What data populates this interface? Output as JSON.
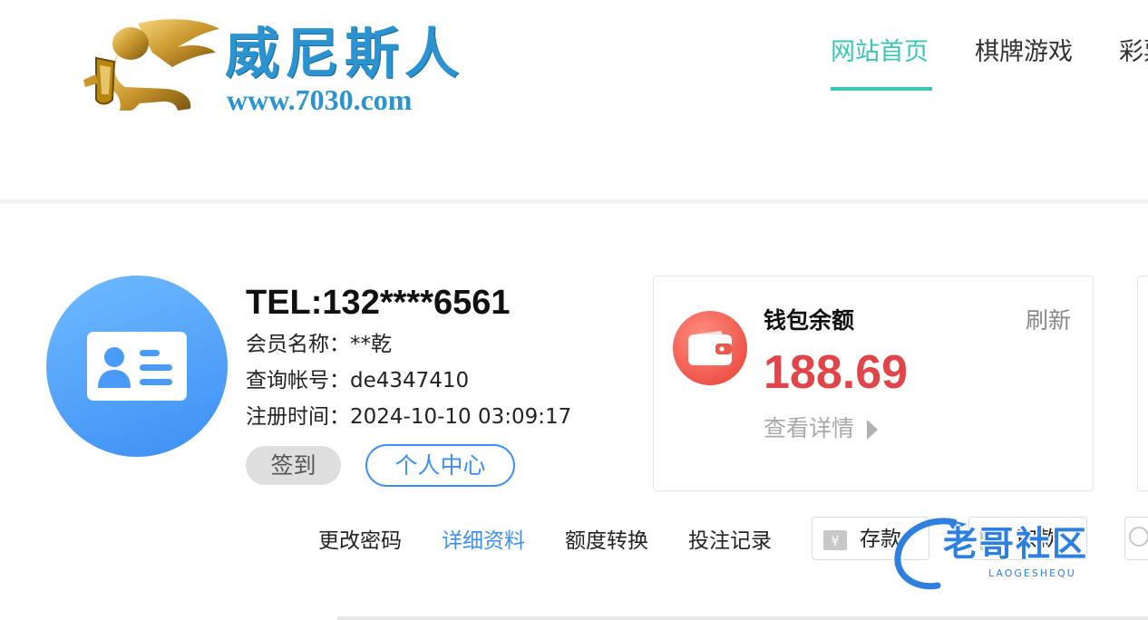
{
  "header": {
    "logo": {
      "name_cn": "威尼斯人",
      "url": "www.7030.com"
    },
    "nav": [
      {
        "label": "网站首页",
        "active": true
      },
      {
        "label": "棋牌游戏",
        "active": false
      },
      {
        "label": "彩票",
        "active": false
      }
    ]
  },
  "profile": {
    "tel": "TEL:132****6561",
    "rows": [
      {
        "label": "会员名称：",
        "value": "**乾"
      },
      {
        "label": "查询帐号：",
        "value": "de4347410"
      },
      {
        "label": "注册时间：",
        "value": "2024-10-10 03:09:17"
      }
    ],
    "sign_in_label": "签到",
    "personal_center_label": "个人中心"
  },
  "wallet": {
    "title": "钱包余额",
    "refresh_label": "刷新",
    "amount": "188.69",
    "detail_label": "查看详情"
  },
  "actions": {
    "links": [
      {
        "label": "更改密码",
        "active": false
      },
      {
        "label": "详细资料",
        "active": true
      },
      {
        "label": "额度转换",
        "active": false
      },
      {
        "label": "投注记录",
        "active": false
      }
    ],
    "deposit": {
      "label": "存款",
      "icon": "¥"
    },
    "withdraw": {
      "label": "取款"
    }
  },
  "watermark": {
    "text": "老哥社区",
    "sub": "LAOGESHEQU"
  },
  "colors": {
    "nav_active": "#3cc5b5",
    "accent_blue": "#3d8ff5",
    "amount_red": "#e0454a",
    "logo_blue": "#2b93cf"
  }
}
